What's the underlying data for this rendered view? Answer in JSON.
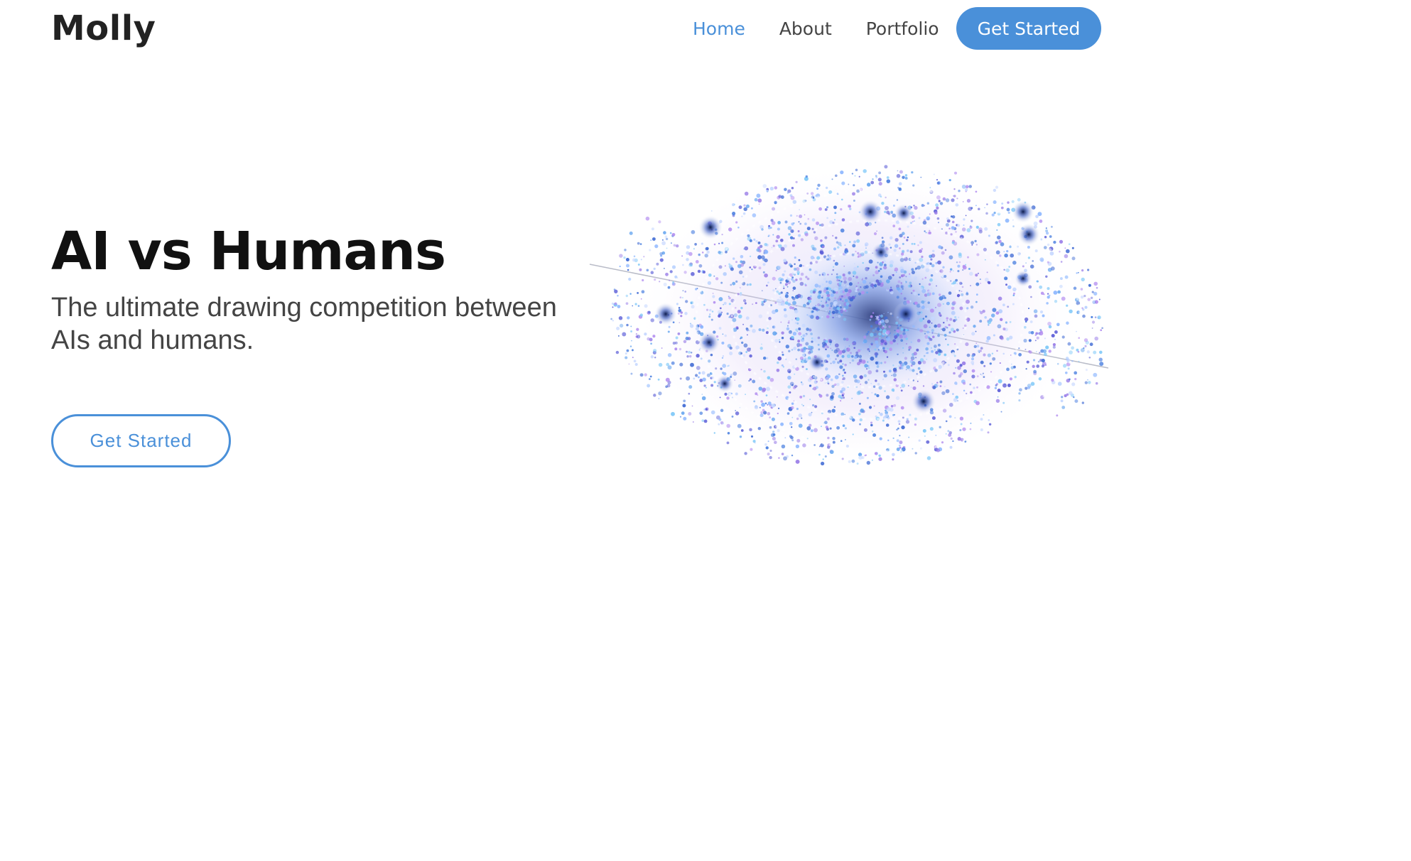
{
  "header": {
    "logo": "Molly",
    "nav": {
      "home": "Home",
      "about": "About",
      "portfolio": "Portfolio"
    },
    "cta_label": "Get Started"
  },
  "hero": {
    "title": "AI vs Humans",
    "subtitle": "The ultimate drawing competition between AIs and humans.",
    "cta_label": "Get Started",
    "illustration": "swirling-galaxy-particles"
  },
  "colors": {
    "accent": "#4a90d9",
    "text_dark": "#111111",
    "text_muted": "#444444",
    "background": "#ffffff"
  }
}
